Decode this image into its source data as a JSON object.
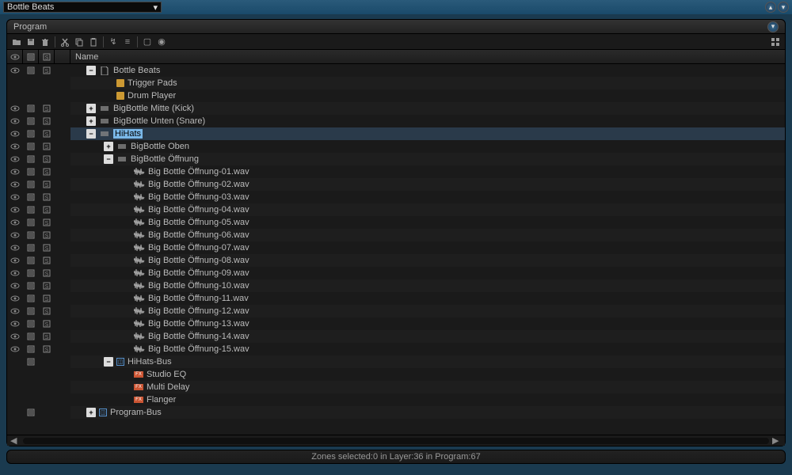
{
  "topbar": {
    "preset": "Bottle Beats"
  },
  "panel": {
    "title": "Program"
  },
  "columns": {
    "name": "Name"
  },
  "tree": [
    {
      "depth": 0,
      "exp": "-",
      "icon": "doc",
      "label": "Bottle Beats",
      "vis": true,
      "mute": true,
      "solo": true
    },
    {
      "depth": 1,
      "exp": "",
      "icon": "pad",
      "label": "Trigger Pads"
    },
    {
      "depth": 1,
      "exp": "",
      "icon": "pad",
      "label": "Drum Player"
    },
    {
      "depth": 0,
      "exp": "+",
      "icon": "layer",
      "label": "BigBottle Mitte (Kick)",
      "vis": true,
      "mute": true,
      "solo": true
    },
    {
      "depth": 0,
      "exp": "+",
      "icon": "layer",
      "label": "BigBottle Unten (Snare)",
      "vis": true,
      "mute": true,
      "solo": true
    },
    {
      "depth": 0,
      "exp": "-",
      "icon": "layer",
      "label": "HiHats",
      "vis": true,
      "mute": true,
      "solo": true,
      "selected": true
    },
    {
      "depth": 1,
      "exp": "+",
      "icon": "layer",
      "label": "BigBottle Oben",
      "vis": true,
      "mute": true,
      "solo": true
    },
    {
      "depth": 1,
      "exp": "-",
      "icon": "layer",
      "label": "BigBottle Öffnung",
      "vis": true,
      "mute": true,
      "solo": true
    },
    {
      "depth": 2,
      "exp": "",
      "icon": "wave",
      "label": "Big Bottle Öffnung-01.wav",
      "vis": true,
      "mute": true,
      "solo": true
    },
    {
      "depth": 2,
      "exp": "",
      "icon": "wave",
      "label": "Big Bottle Öffnung-02.wav",
      "vis": true,
      "mute": true,
      "solo": true
    },
    {
      "depth": 2,
      "exp": "",
      "icon": "wave",
      "label": "Big Bottle Öffnung-03.wav",
      "vis": true,
      "mute": true,
      "solo": true
    },
    {
      "depth": 2,
      "exp": "",
      "icon": "wave",
      "label": "Big Bottle Öffnung-04.wav",
      "vis": true,
      "mute": true,
      "solo": true
    },
    {
      "depth": 2,
      "exp": "",
      "icon": "wave",
      "label": "Big Bottle Öffnung-05.wav",
      "vis": true,
      "mute": true,
      "solo": true
    },
    {
      "depth": 2,
      "exp": "",
      "icon": "wave",
      "label": "Big Bottle Öffnung-06.wav",
      "vis": true,
      "mute": true,
      "solo": true
    },
    {
      "depth": 2,
      "exp": "",
      "icon": "wave",
      "label": "Big Bottle Öffnung-07.wav",
      "vis": true,
      "mute": true,
      "solo": true
    },
    {
      "depth": 2,
      "exp": "",
      "icon": "wave",
      "label": "Big Bottle Öffnung-08.wav",
      "vis": true,
      "mute": true,
      "solo": true
    },
    {
      "depth": 2,
      "exp": "",
      "icon": "wave",
      "label": "Big Bottle Öffnung-09.wav",
      "vis": true,
      "mute": true,
      "solo": true
    },
    {
      "depth": 2,
      "exp": "",
      "icon": "wave",
      "label": "Big Bottle Öffnung-10.wav",
      "vis": true,
      "mute": true,
      "solo": true
    },
    {
      "depth": 2,
      "exp": "",
      "icon": "wave",
      "label": "Big Bottle Öffnung-11.wav",
      "vis": true,
      "mute": true,
      "solo": true
    },
    {
      "depth": 2,
      "exp": "",
      "icon": "wave",
      "label": "Big Bottle Öffnung-12.wav",
      "vis": true,
      "mute": true,
      "solo": true
    },
    {
      "depth": 2,
      "exp": "",
      "icon": "wave",
      "label": "Big Bottle Öffnung-13.wav",
      "vis": true,
      "mute": true,
      "solo": true
    },
    {
      "depth": 2,
      "exp": "",
      "icon": "wave",
      "label": "Big Bottle Öffnung-14.wav",
      "vis": true,
      "mute": true,
      "solo": true
    },
    {
      "depth": 2,
      "exp": "",
      "icon": "wave",
      "label": "Big Bottle Öffnung-15.wav",
      "vis": true,
      "mute": true,
      "solo": true
    },
    {
      "depth": 1,
      "exp": "-",
      "icon": "bus",
      "label": "HiHats-Bus",
      "mute": true
    },
    {
      "depth": 2,
      "exp": "",
      "icon": "fx",
      "label": "Studio EQ"
    },
    {
      "depth": 2,
      "exp": "",
      "icon": "fx",
      "label": "Multi Delay"
    },
    {
      "depth": 2,
      "exp": "",
      "icon": "fx",
      "label": "Flanger"
    },
    {
      "depth": 0,
      "exp": "+",
      "icon": "bus",
      "label": "Program-Bus",
      "mute": true
    }
  ],
  "status": {
    "text": "Zones selected:0  in Layer:36  in Program:67"
  }
}
